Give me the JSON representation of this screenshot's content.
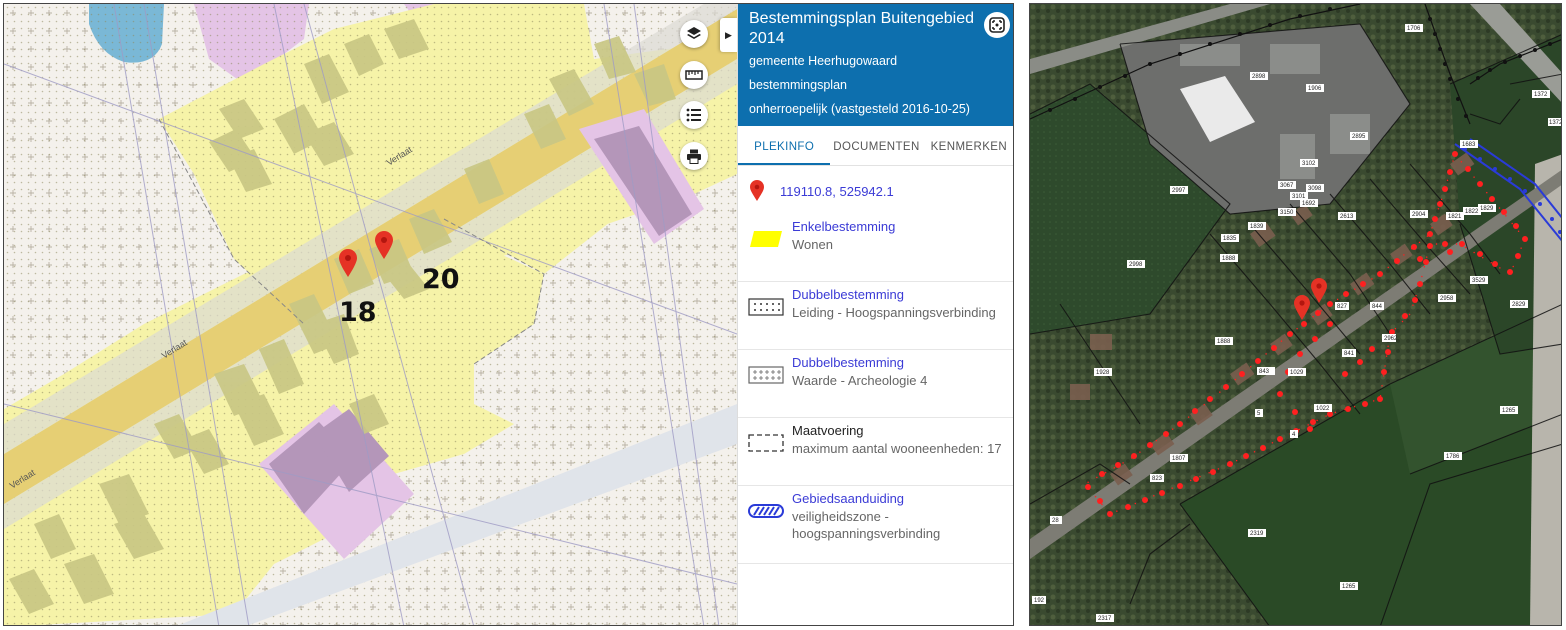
{
  "left_map": {
    "street_labels": [
      "Verlaat",
      "Verlaat",
      "Verlaat"
    ],
    "house_numbers": {
      "n18": "18",
      "n20": "20"
    },
    "colors": {
      "wonen": "#f6f3a8",
      "buildings": "#c9c784",
      "purple": "#e4c4e6",
      "purple_building": "#b496b9",
      "road": "#e6cf74",
      "water": "#7ab8d6"
    }
  },
  "map_controls": [
    {
      "name": "layers-icon"
    },
    {
      "name": "ruler-icon"
    },
    {
      "name": "legend-list-icon"
    },
    {
      "name": "print-icon"
    }
  ],
  "panel": {
    "title": "Bestemmingsplan Buitengebied 2014",
    "municipality": "gemeente Heerhugowaard",
    "type": "bestemmingsplan",
    "status": "onherroepelijk (vastgesteld 2016-10-25)",
    "tabs": [
      "PLEKINFO",
      "DOCUMENTEN",
      "KENMERKEN"
    ],
    "active_tab": 0,
    "coordinates": "119110.8, 525942.1",
    "entries": [
      {
        "title": "Enkelbestemming",
        "sub": "Wonen",
        "symbol": "yellow-fill"
      },
      {
        "title": "Dubbelbestemming",
        "sub": "Leiding - Hoogspanningsverbinding",
        "symbol": "dot-pattern"
      },
      {
        "title": "Dubbelbestemming",
        "sub": "Waarde - Archeologie 4",
        "symbol": "plus-pattern"
      },
      {
        "title": "Maatvoering",
        "sub": "maximum aantal wooneenheden: 17",
        "symbol": "dashed-box"
      },
      {
        "title": "Gebiedsaanduiding",
        "sub": "veiligheidszone - hoogspanningsverbinding",
        "symbol": "blue-hatch"
      }
    ]
  },
  "right_map": {
    "parcel_labels": [
      "1706",
      "2898",
      "1906",
      "2895",
      "3102",
      "3067",
      "3098",
      "2997",
      "1692",
      "3101",
      "3150",
      "2613",
      "2904",
      "1821",
      "1829",
      "1822",
      "2998",
      "1839",
      "1835",
      "2958",
      "3529",
      "2829",
      "827",
      "1888",
      "2962",
      "844",
      "841",
      "843",
      "1022",
      "1029",
      "1928",
      "1807",
      "823",
      "4",
      "5",
      "1786",
      "2319",
      "1265",
      "28",
      "1372",
      "1683",
      "1372",
      "2317",
      "1265",
      "192",
      "1888"
    ],
    "outline_color": "#ff2020",
    "blue_zone_color": "#2a3bd8"
  }
}
